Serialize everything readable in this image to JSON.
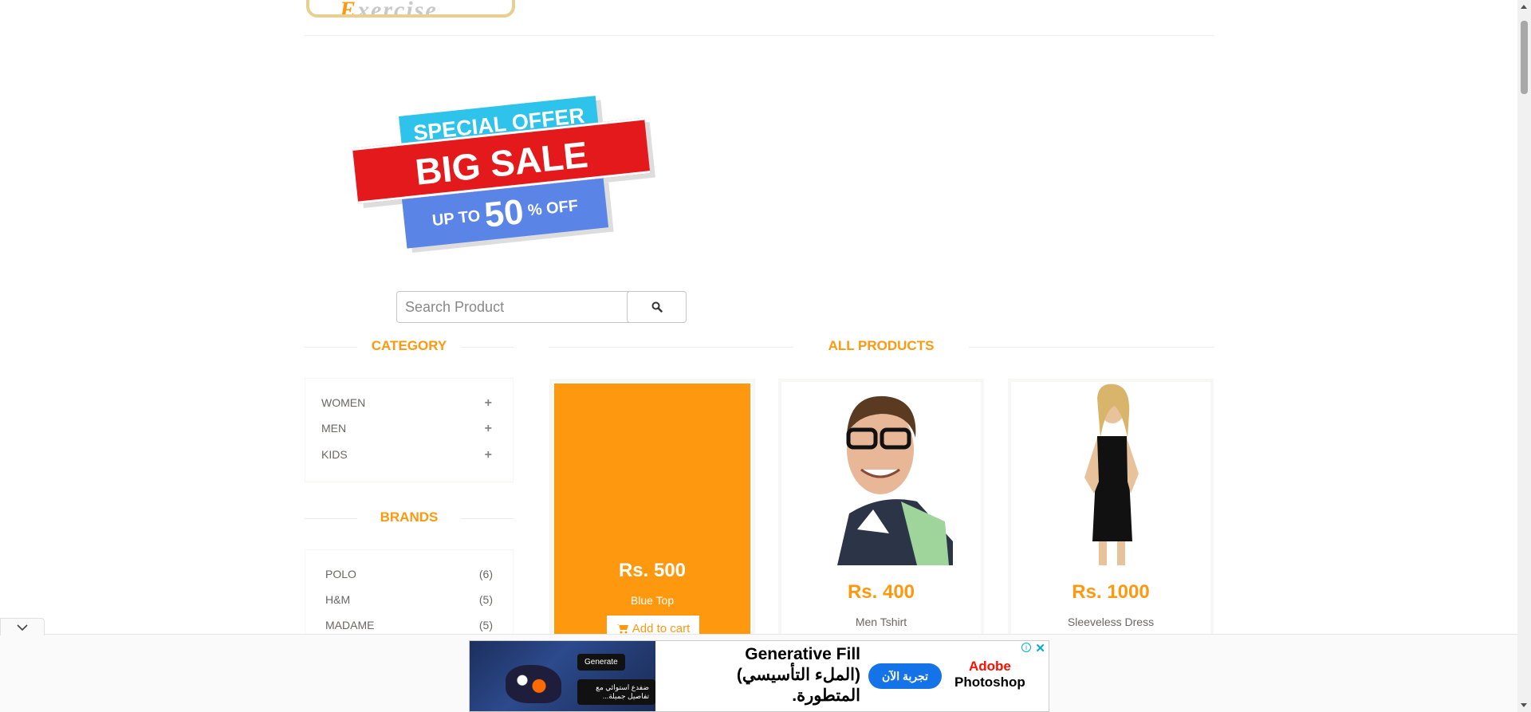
{
  "header": {
    "logo_text_main": "E",
    "logo_text_rest": "xercise"
  },
  "banner": {
    "line1": "SPECIAL OFFER",
    "line2": "BIG SALE",
    "line3_prefix": "UP TO",
    "line3_value": "50",
    "line3_suffix": "% OFF"
  },
  "search": {
    "placeholder": "Search Product",
    "icon": "search-icon"
  },
  "sidebar": {
    "category_title": "CATEGORY",
    "categories": [
      {
        "label": "WOMEN",
        "icon": "plus-icon"
      },
      {
        "label": "MEN",
        "icon": "plus-icon"
      },
      {
        "label": "KIDS",
        "icon": "plus-icon"
      }
    ],
    "brands_title": "BRANDS",
    "brands": [
      {
        "label": "POLO",
        "count": "(6)"
      },
      {
        "label": "H&M",
        "count": "(5)"
      },
      {
        "label": "MADAME",
        "count": "(5)"
      }
    ]
  },
  "main": {
    "title": "ALL PRODUCTS",
    "products": [
      {
        "price": "Rs. 500",
        "name": "Blue Top",
        "cart_label": "Add to cart",
        "hovered": true
      },
      {
        "price": "Rs. 400",
        "name": "Men Tshirt"
      },
      {
        "price": "Rs. 1000",
        "name": "Sleeveless Dress"
      }
    ]
  },
  "ad": {
    "headline_en": "Generative Fill",
    "headline_ar": "(الملء التأسيسي) المتطورة.",
    "cta": "تجربة الآن",
    "brand_line1": "Adobe",
    "brand_line2": "Photoshop",
    "generate_label": "Generate",
    "subcaption": "ضفدع استوائي مع تفاصيل جميلة...",
    "info_icon": "i",
    "close_icon": "✕"
  },
  "colors": {
    "accent": "#FE980F",
    "text": "#696763",
    "adobe_red": "#FA0F00",
    "cta_blue": "#1473E6"
  }
}
